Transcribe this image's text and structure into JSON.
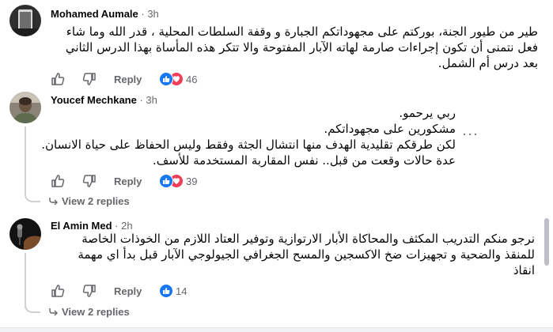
{
  "comments": [
    {
      "author": "Mohamed Aumale",
      "time": " · 3h",
      "lines": [
        "طير من طيور الجنة، بوركتم على مجهوداتكم الجبارة و وقفة السلطات المحلية ، قدر الله وما شاء",
        "فعل نتمنى أن تكون إجراءات صارمة لهاته الآبار المفتوحة والا تتكر هذه المأساة بهذا الدرس الثاني",
        "بعد درس أم الشمل."
      ],
      "reply_label": "Reply",
      "reaction_count": "46",
      "reactions": [
        "like",
        "love"
      ]
    },
    {
      "author": "Youcef Mechkane",
      "time": " · 3h",
      "lines": [
        "ربي يرحمو.",
        "مشكورين على مجهوداتكم.",
        "لكن طرقكم تقليدية الهدف منها انتشال الجثة وفقط وليس الحفاظ على حياة الانسان.",
        "عدة حالات وقعت من قبل.. نفس المقاربة المستخدمة للأسف."
      ],
      "more_label": "···",
      "reply_label": "Reply",
      "reaction_count": "39",
      "reactions": [
        "like",
        "love"
      ],
      "view_replies": "View 2 replies"
    },
    {
      "author": "El Amin Med",
      "time": " · 2h",
      "lines": [
        "نرجو منكم التدريب المكثف والمحاكاة الأبار الارتوازية وتوفير العتاد اللازم من الخوذات الخاصة",
        "للمنقذ والضحية و تجهيزات ضخ الاكسجين والمسح الجغرافي الجيولوجي الآبار قبل بدأ اي مهمة",
        "انقاذ"
      ],
      "reply_label": "Reply",
      "reaction_count": "14",
      "reactions": [
        "like"
      ],
      "view_replies": "View 2 replies"
    }
  ],
  "colors": {
    "like": "#1877f2",
    "love": "#f33e58",
    "secondary_text": "#65676b",
    "primary_text": "#050505"
  },
  "icons": [
    "like-icon",
    "dislike-icon",
    "heart-icon",
    "more-options-icon",
    "reply-arrow-icon"
  ]
}
